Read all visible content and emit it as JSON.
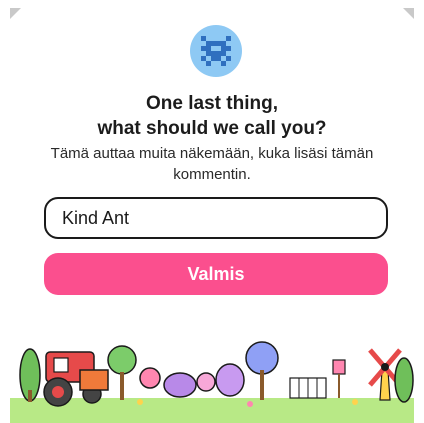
{
  "dialog": {
    "title_line1": "One last thing,",
    "title_line2": "what should we call you?",
    "description": "Tämä auttaa muita näkemään, kuka lisäsi tämän kommentin.",
    "name_input": {
      "value": "Kind Ant",
      "placeholder": ""
    },
    "done_label": "Valmis"
  },
  "colors": {
    "avatar_bg": "#8ec9f4",
    "avatar_fg": "#2f6fbf",
    "button": "#fb4f8e",
    "ground": "#b8e986"
  },
  "icons": {
    "avatar": "pixel-ant-icon",
    "decoration": "garden-illustration"
  }
}
